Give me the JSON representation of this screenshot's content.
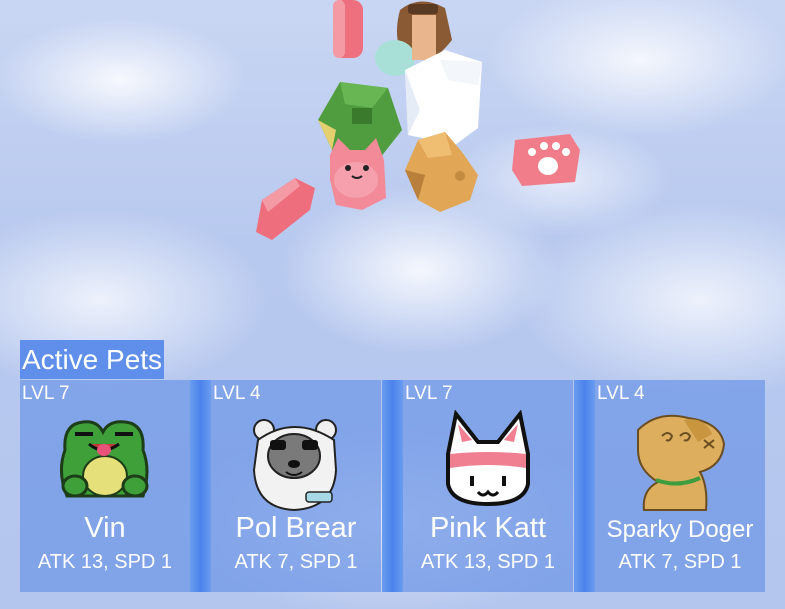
{
  "panel": {
    "title": "Active Pets",
    "pets": [
      {
        "level": "LVL 7",
        "name": "Vin",
        "stats": "ATK 13, SPD 1",
        "icon": "frog-icon"
      },
      {
        "level": "LVL 4",
        "name": "Pol Brear",
        "stats": "ATK 7, SPD 1",
        "icon": "polar-bear-icon"
      },
      {
        "level": "LVL 7",
        "name": "Pink Katt",
        "stats": "ATK 13, SPD 1",
        "icon": "cat-icon"
      },
      {
        "level": "LVL 4",
        "name": "Sparky Doger",
        "stats": "ATK 7, SPD 1",
        "icon": "dog-icon"
      }
    ]
  },
  "colors": {
    "panel_title_bg": "#5f8fea",
    "card_bg": "#6e96e6",
    "paw_pink": "#f07f8c"
  }
}
